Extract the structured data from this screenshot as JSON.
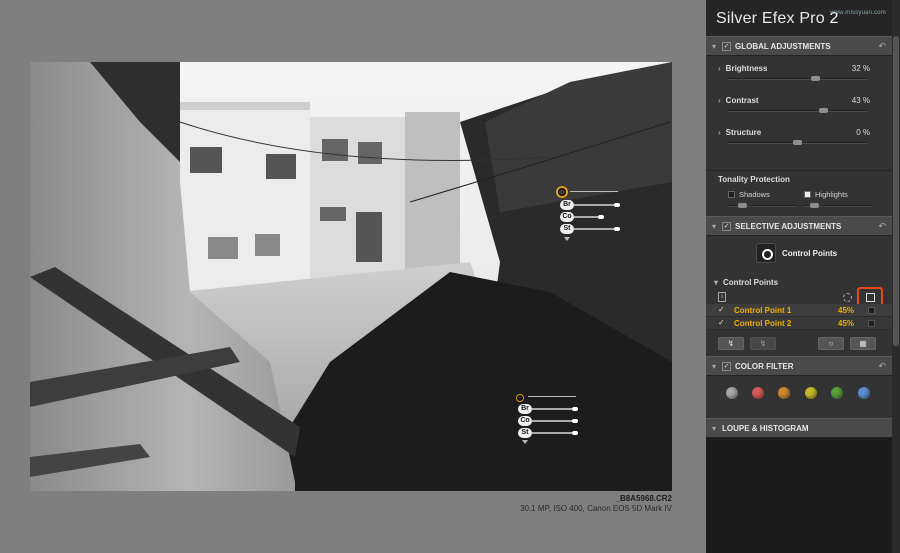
{
  "app": {
    "title": "Silver Efex Pro",
    "version": "2",
    "watermark": "www.missyuan.com"
  },
  "photo": {
    "filename": "_B8A5968.CR2",
    "info": "30.1 MP, ISO 400, Canon EOS 5D Mark IV"
  },
  "control_point_labels": [
    "Br",
    "Co",
    "St"
  ],
  "panel": {
    "global": {
      "title": "GLOBAL ADJUSTMENTS",
      "sliders": [
        {
          "label": "Brightness",
          "value": "32 %",
          "level": 0.62
        },
        {
          "label": "Contrast",
          "value": "43 %",
          "level": 0.68
        },
        {
          "label": "Structure",
          "value": "0 %",
          "level": 0.5
        }
      ],
      "tonality": {
        "title": "Tonality Protection",
        "shadows": "Shadows",
        "highlights": "Highlights"
      }
    },
    "selective": {
      "title": "SELECTIVE ADJUSTMENTS",
      "control_points_button": "Control Points",
      "list_title": "Control Points",
      "info_icon": "i",
      "items": [
        {
          "name": "Control Point 1",
          "percent": "45%"
        },
        {
          "name": "Control Point 2",
          "percent": "45%"
        }
      ]
    },
    "color_filter": {
      "title": "COLOR FILTER",
      "swatches": [
        "#a8a8a8",
        "#d65a5a",
        "#d2892e",
        "#c8b82a",
        "#5aa03a",
        "#5c8ed4"
      ]
    },
    "loupe": {
      "title": "LOUPE & HISTOGRAM"
    }
  },
  "colors": {
    "accent": "#f0b000",
    "highlight_box": "#e84a1a"
  }
}
